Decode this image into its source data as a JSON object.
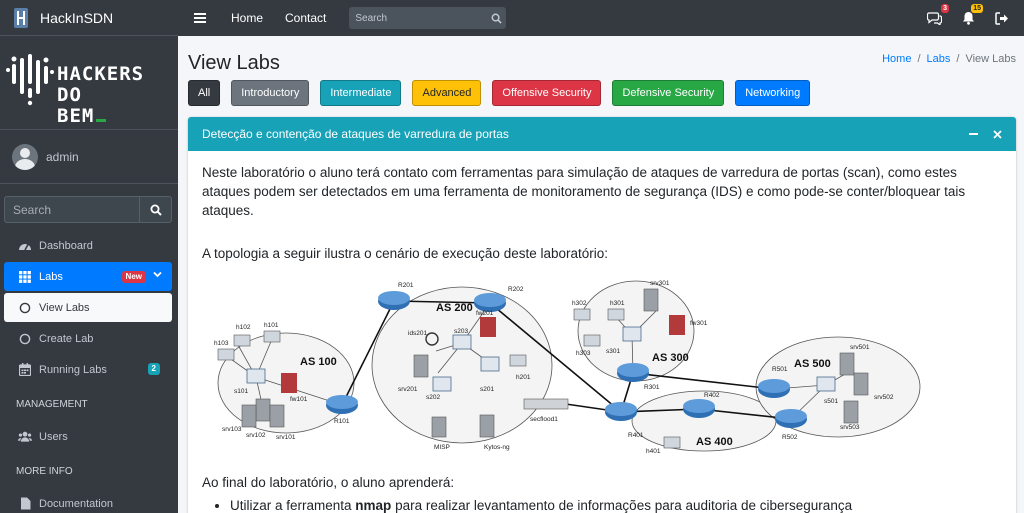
{
  "topbar": {
    "brand": "HackInSDN",
    "nav": [
      "Home",
      "Contact"
    ],
    "search_placeholder": "Search",
    "messages_count": "3",
    "notifications_count": "15"
  },
  "sidebar": {
    "logo_lines": [
      "HACKERS",
      "DO",
      "BEM"
    ],
    "user": "admin",
    "search_placeholder": "Search",
    "items": {
      "dashboard": "Dashboard",
      "labs": "Labs",
      "labs_badge": "New",
      "view_labs": "View Labs",
      "create_lab": "Create Lab",
      "running_labs": "Running Labs",
      "running_labs_count": "2",
      "management_header": "MANAGEMENT",
      "users": "Users",
      "more_info_header": "MORE INFO",
      "documentation": "Documentation"
    }
  },
  "page": {
    "title": "View Labs",
    "breadcrumb": [
      "Home",
      "Labs",
      "View Labs"
    ],
    "filters": [
      {
        "label": "All",
        "bg": "#343a40",
        "fg": "#ffffff"
      },
      {
        "label": "Introductory",
        "bg": "#6c757d",
        "fg": "#ffffff"
      },
      {
        "label": "Intermediate",
        "bg": "#17a2b8",
        "fg": "#ffffff"
      },
      {
        "label": "Advanced",
        "bg": "#ffc107",
        "fg": "#212529"
      },
      {
        "label": "Offensive Security",
        "bg": "#dc3545",
        "fg": "#ffffff"
      },
      {
        "label": "Defensive Security",
        "bg": "#28a745",
        "fg": "#ffffff"
      },
      {
        "label": "Networking",
        "bg": "#007bff",
        "fg": "#ffffff"
      }
    ]
  },
  "card": {
    "title": "Detecção e contenção de ataques de varredura de portas",
    "intro": "Neste laboratório o aluno terá contato com ferramentas para simulação de ataques de varredura de portas (scan), como estes ataques podem ser detectados em uma ferramenta de monitoramento de segurança (IDS) e como  pode-se conter/bloquear tais ataques.",
    "topology_intro": "A topologia a seguir ilustra o cenário de execução deste laboratório:",
    "learn_intro": "Ao final do laboratório, o aluno aprenderá:",
    "learn_item_prefix": "Utilizar a ferramenta ",
    "learn_item_bold": "nmap",
    "learn_item_suffix": " para realizar levantamento de informações para auditoria de cibersegurança"
  },
  "topology": {
    "as_labels": [
      "AS 100",
      "AS 200",
      "AS 300",
      "AS 400",
      "AS 500"
    ],
    "router_labels": [
      "R101",
      "R201",
      "R202",
      "R301",
      "R401",
      "R402",
      "R501",
      "R502"
    ],
    "host_labels": [
      "h101",
      "h102",
      "h103",
      "h201",
      "h301",
      "h302",
      "h303",
      "h401"
    ],
    "switch_labels": [
      "s101",
      "s201",
      "s202",
      "s203",
      "s301",
      "s501"
    ],
    "server_labels": [
      "srv101",
      "srv102",
      "srv103",
      "srv201",
      "srv301",
      "srv501",
      "srv502",
      "srv503"
    ],
    "firewall_labels": [
      "fw101",
      "fw201",
      "fw301"
    ],
    "other_labels": [
      "ids201",
      "secflood1",
      "MISP",
      "Kytos-ng"
    ]
  }
}
